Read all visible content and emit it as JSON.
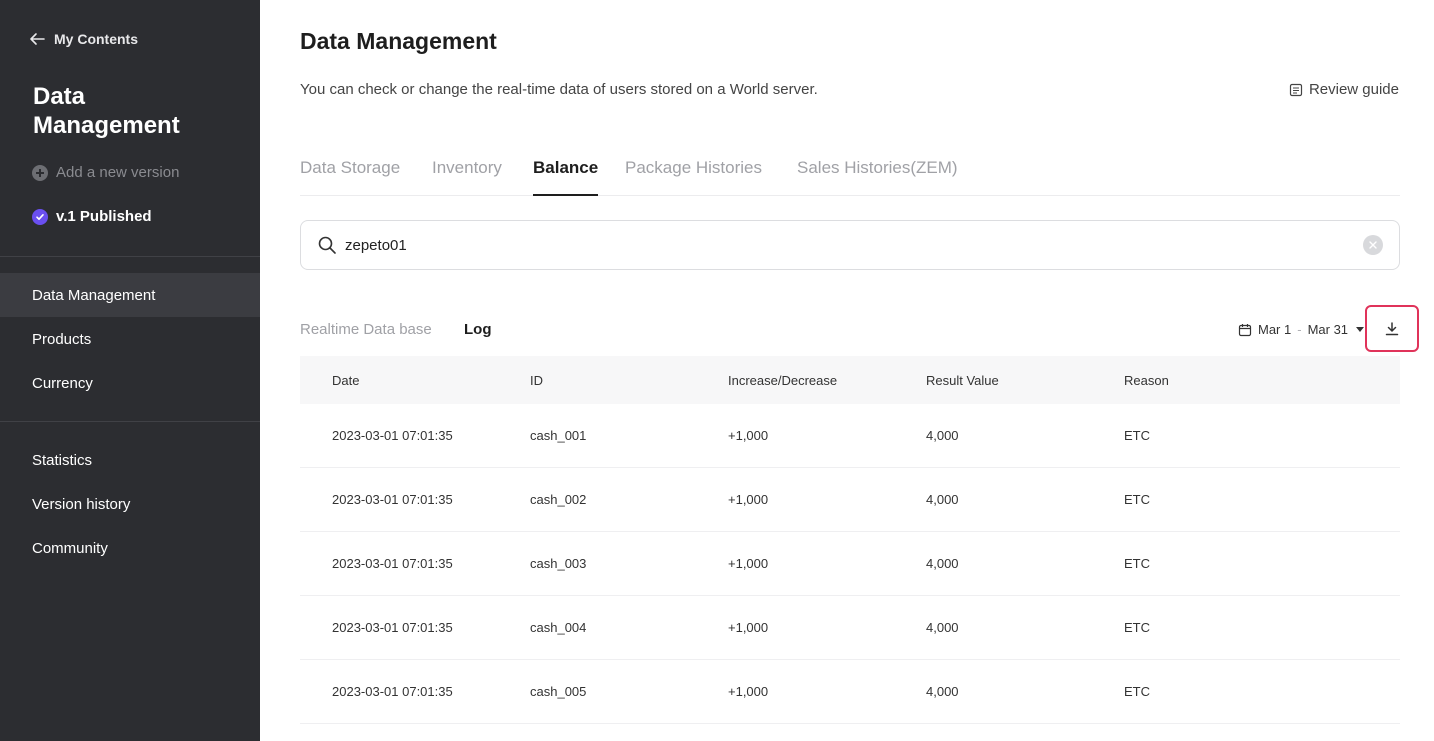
{
  "sidebar": {
    "back_label": "My Contents",
    "title": "Data Management",
    "add_version": "Add a new version",
    "published": "v.1 Published",
    "nav_primary": [
      "Data Management",
      "Products",
      "Currency"
    ],
    "nav_secondary": [
      "Statistics",
      "Version history",
      "Community"
    ],
    "active_item": "Data Management"
  },
  "header": {
    "title": "Data Management",
    "description": "You can check or change the real-time data of users stored on a World server.",
    "review_guide": "Review guide"
  },
  "tabs": [
    "Data Storage",
    "Inventory",
    "Balance",
    "Package Histories",
    "Sales Histories(ZEM)"
  ],
  "active_tab": "Balance",
  "search": {
    "value": "zepeto01"
  },
  "subtabs": {
    "realtime": "Realtime Data base",
    "log": "Log"
  },
  "date_range": {
    "start": "Mar 1",
    "separator": "-",
    "end": "Mar 31"
  },
  "table": {
    "headers": [
      "Date",
      "ID",
      "Increase/Decrease",
      "Result Value",
      "Reason"
    ],
    "rows": [
      [
        "2023-03-01 07:01:35",
        "cash_001",
        "+1,000",
        "4,000",
        "ETC"
      ],
      [
        "2023-03-01 07:01:35",
        "cash_002",
        "+1,000",
        "4,000",
        "ETC"
      ],
      [
        "2023-03-01 07:01:35",
        "cash_003",
        "+1,000",
        "4,000",
        "ETC"
      ],
      [
        "2023-03-01 07:01:35",
        "cash_004",
        "+1,000",
        "4,000",
        "ETC"
      ],
      [
        "2023-03-01 07:01:35",
        "cash_005",
        "+1,000",
        "4,000",
        "ETC"
      ]
    ]
  },
  "colors": {
    "sidebar_bg": "#2c2d31",
    "accent_purple": "#6a4ff0",
    "highlight_red": "#e0335a"
  },
  "icons": [
    "arrow-left-icon",
    "plus-circle-icon",
    "check-circle-icon",
    "document-icon",
    "search-icon",
    "clear-icon",
    "calendar-icon",
    "download-icon"
  ]
}
